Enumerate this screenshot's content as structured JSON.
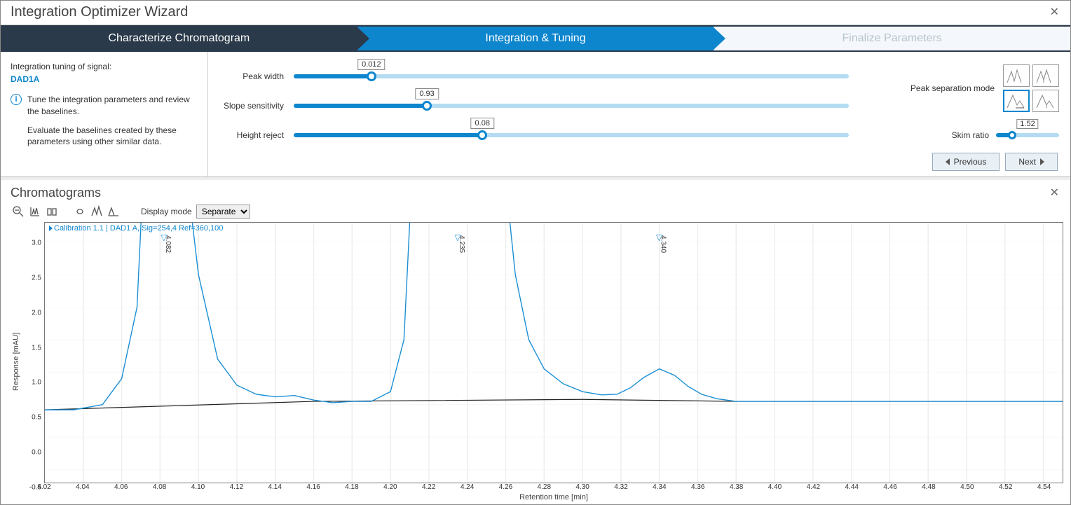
{
  "window": {
    "title": "Integration Optimizer Wizard"
  },
  "steps": {
    "s1": "Characterize Chromatogram",
    "s2": "Integration & Tuning",
    "s3": "Finalize Parameters"
  },
  "left": {
    "heading": "Integration tuning of signal:",
    "signal": "DAD1A",
    "info1": "Tune the integration parameters and review the baselines.",
    "info2": "Evaluate the baselines created by these parameters using other similar data."
  },
  "sliders": {
    "peak_width": {
      "label": "Peak width",
      "value": "0.012",
      "pct": 14
    },
    "slope": {
      "label": "Slope sensitivity",
      "value": "0.93",
      "pct": 24
    },
    "height": {
      "label": "Height reject",
      "value": "0.08",
      "pct": 34
    }
  },
  "mode": {
    "title": "Peak separation mode",
    "skim_label": "Skim ratio",
    "skim_value": "1.52",
    "skim_pct": 25
  },
  "nav": {
    "prev": "Previous",
    "next": "Next"
  },
  "chrom": {
    "title": "Chromatograms",
    "display_label": "Display mode",
    "display_value": "Separate",
    "plot_title": "Calibration 1.1 | DAD1 A, Sig=254,4 Ref=360,100",
    "xlabel": "Retention time [min]",
    "ylabel": "Response [mAU]"
  },
  "chart_data": {
    "type": "line",
    "xlabel": "Retention time [min]",
    "ylabel": "Response [mAU]",
    "x_ticks": [
      "4.02",
      "4.04",
      "4.06",
      "4.08",
      "4.10",
      "4.12",
      "4.14",
      "4.16",
      "4.18",
      "4.20",
      "4.22",
      "4.24",
      "4.26",
      "4.28",
      "4.30",
      "4.32",
      "4.34",
      "4.36",
      "4.38",
      "4.40",
      "4.42",
      "4.44",
      "4.46",
      "4.48",
      "4.50",
      "4.52",
      "4.54"
    ],
    "y_ticks": [
      "-0.5",
      "0.0",
      "0.5",
      "1.0",
      "1.5",
      "2.0",
      "2.5",
      "3.0"
    ],
    "xlim": [
      4.02,
      4.55
    ],
    "ylim": [
      -0.7,
      3.3
    ],
    "peak_labels": [
      {
        "x": 4.082,
        "text": "4.082"
      },
      {
        "x": 4.235,
        "text": "4.235"
      },
      {
        "x": 4.34,
        "text": "4.340"
      }
    ],
    "baseline": [
      {
        "x": 4.02,
        "y": 0.42
      },
      {
        "x": 4.16,
        "y": 0.55
      },
      {
        "x": 4.3,
        "y": 0.58
      },
      {
        "x": 4.38,
        "y": 0.55
      },
      {
        "x": 4.55,
        "y": 0.55
      }
    ],
    "trace": [
      {
        "x": 4.02,
        "y": 0.42
      },
      {
        "x": 4.035,
        "y": 0.42
      },
      {
        "x": 4.05,
        "y": 0.5
      },
      {
        "x": 4.06,
        "y": 0.9
      },
      {
        "x": 4.068,
        "y": 2.0
      },
      {
        "x": 4.072,
        "y": 4.5
      },
      {
        "x": 4.092,
        "y": 4.5
      },
      {
        "x": 4.1,
        "y": 2.5
      },
      {
        "x": 4.11,
        "y": 1.2
      },
      {
        "x": 4.12,
        "y": 0.8
      },
      {
        "x": 4.13,
        "y": 0.66
      },
      {
        "x": 4.14,
        "y": 0.62
      },
      {
        "x": 4.15,
        "y": 0.64
      },
      {
        "x": 4.16,
        "y": 0.57
      },
      {
        "x": 4.17,
        "y": 0.53
      },
      {
        "x": 4.18,
        "y": 0.55
      },
      {
        "x": 4.19,
        "y": 0.55
      },
      {
        "x": 4.2,
        "y": 0.7
      },
      {
        "x": 4.207,
        "y": 1.5
      },
      {
        "x": 4.212,
        "y": 4.5
      },
      {
        "x": 4.258,
        "y": 4.5
      },
      {
        "x": 4.265,
        "y": 2.5
      },
      {
        "x": 4.272,
        "y": 1.5
      },
      {
        "x": 4.28,
        "y": 1.05
      },
      {
        "x": 4.29,
        "y": 0.82
      },
      {
        "x": 4.3,
        "y": 0.7
      },
      {
        "x": 4.31,
        "y": 0.65
      },
      {
        "x": 4.318,
        "y": 0.66
      },
      {
        "x": 4.325,
        "y": 0.76
      },
      {
        "x": 4.332,
        "y": 0.92
      },
      {
        "x": 4.34,
        "y": 1.05
      },
      {
        "x": 4.348,
        "y": 0.95
      },
      {
        "x": 4.355,
        "y": 0.78
      },
      {
        "x": 4.362,
        "y": 0.66
      },
      {
        "x": 4.37,
        "y": 0.59
      },
      {
        "x": 4.38,
        "y": 0.55
      },
      {
        "x": 4.4,
        "y": 0.55
      },
      {
        "x": 4.45,
        "y": 0.55
      },
      {
        "x": 4.5,
        "y": 0.55
      },
      {
        "x": 4.55,
        "y": 0.55
      }
    ]
  }
}
